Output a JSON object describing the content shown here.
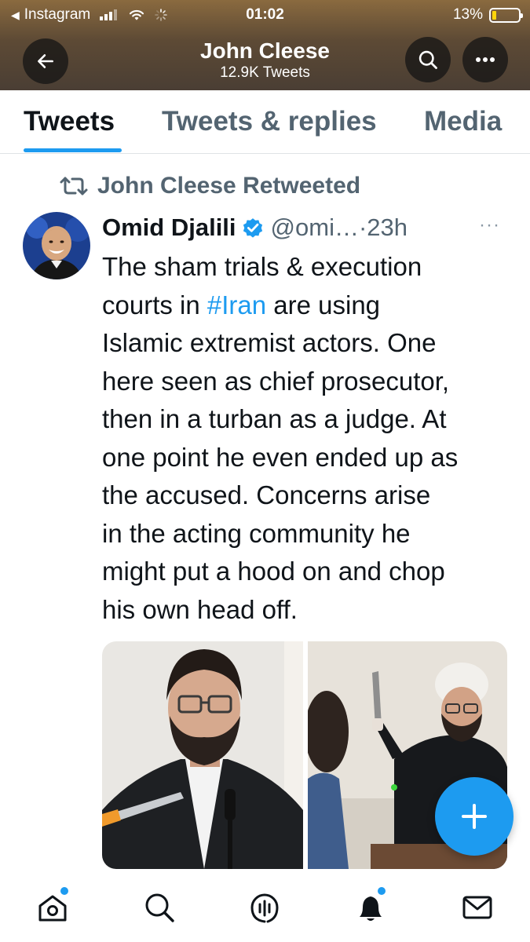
{
  "status_bar": {
    "back_app": "Instagram",
    "time": "01:02",
    "battery": "13%"
  },
  "header": {
    "name": "John Cleese",
    "tweet_count": "12.9K Tweets"
  },
  "tabs": [
    {
      "label": "Tweets",
      "active": true
    },
    {
      "label": "Tweets & replies",
      "active": false
    },
    {
      "label": "Media",
      "active": false
    }
  ],
  "tweet": {
    "retweet_label": "John Cleese Retweeted",
    "author_name": "Omid Djalili",
    "author_handle": "@omi…",
    "separator": "·",
    "time": "23h",
    "more_label": "···",
    "text_lines": [
      "The sham trials & execution",
      "courts in ",
      "Islamic extremist actors. One",
      "here seen as chief prosecutor,",
      "then in a turban as a judge. At",
      "one point he even ended up as",
      "the accused. Concerns arise",
      "in the acting community he",
      "might put a hood on and chop",
      "his own head off."
    ],
    "hashtag": "#Iran",
    "line2_suffix": " are using"
  },
  "bottom_nav": [
    {
      "icon": "home-icon",
      "badge": true
    },
    {
      "icon": "search-icon",
      "badge": false
    },
    {
      "icon": "spaces-icon",
      "badge": false
    },
    {
      "icon": "notifications-icon",
      "badge": true
    },
    {
      "icon": "messages-icon",
      "badge": false
    }
  ],
  "colors": {
    "accent": "#1d9bf0",
    "secondary_text": "#536471"
  }
}
